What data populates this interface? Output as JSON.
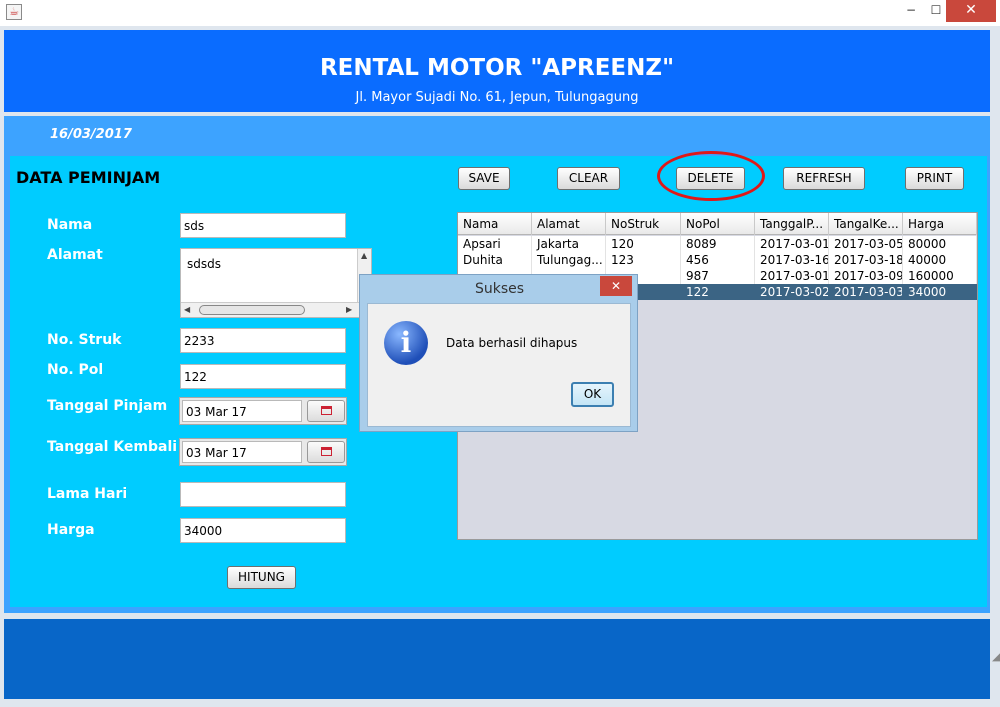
{
  "window": {
    "minimize": "−",
    "maximize": "☐",
    "close": "✕"
  },
  "header": {
    "title": "RENTAL MOTOR \"APREENZ\"",
    "address": "Jl. Mayor Sujadi No. 61, Jepun, Tulungagung"
  },
  "date": "16/03/2017",
  "form": {
    "section_title": "DATA PEMINJAM",
    "labels": {
      "nama": "Nama",
      "alamat": "Alamat",
      "no_struk": "No. Struk",
      "no_pol": "No. Pol",
      "tanggal_pinjam": "Tanggal Pinjam",
      "tanggal_kembali": "Tanggal Kembali",
      "lama_hari": "Lama Hari",
      "harga": "Harga"
    },
    "values": {
      "nama": "sds",
      "alamat": "sdsds",
      "no_struk": "2233",
      "no_pol": "122",
      "tanggal_pinjam": "03 Mar 17",
      "tanggal_kembali": "03 Mar 17",
      "lama_hari": "",
      "harga": "34000"
    },
    "hitung_label": "HITUNG"
  },
  "toolbar": {
    "save": "SAVE",
    "clear": "CLEAR",
    "delete": "DELETE",
    "refresh": "REFRESH",
    "print": "PRINT"
  },
  "table": {
    "columns": [
      "Nama",
      "Alamat",
      "NoStruk",
      "NoPol",
      "TanggalP...",
      "TangalKe...",
      "Harga"
    ],
    "rows": [
      [
        "Apsari",
        "Jakarta",
        "120",
        "8089",
        "2017-03-01",
        "2017-03-05",
        "80000"
      ],
      [
        "Duhita",
        "Tulungag...",
        "123",
        "456",
        "2017-03-16",
        "2017-03-18",
        "40000"
      ],
      [
        "",
        "",
        "",
        "987",
        "2017-03-01",
        "2017-03-09",
        "160000"
      ],
      [
        "",
        "",
        "",
        "122",
        "2017-03-02",
        "2017-03-03",
        "34000"
      ]
    ]
  },
  "dialog": {
    "title": "Sukses",
    "message": "Data berhasil dihapus",
    "ok": "OK",
    "close": "✕"
  },
  "colors": {
    "header": "#0a6cff",
    "band": "#3da3ff",
    "content": "#00ccff",
    "footer": "#0866c8",
    "selection": "#3b6484",
    "highlight": "#e01818"
  }
}
